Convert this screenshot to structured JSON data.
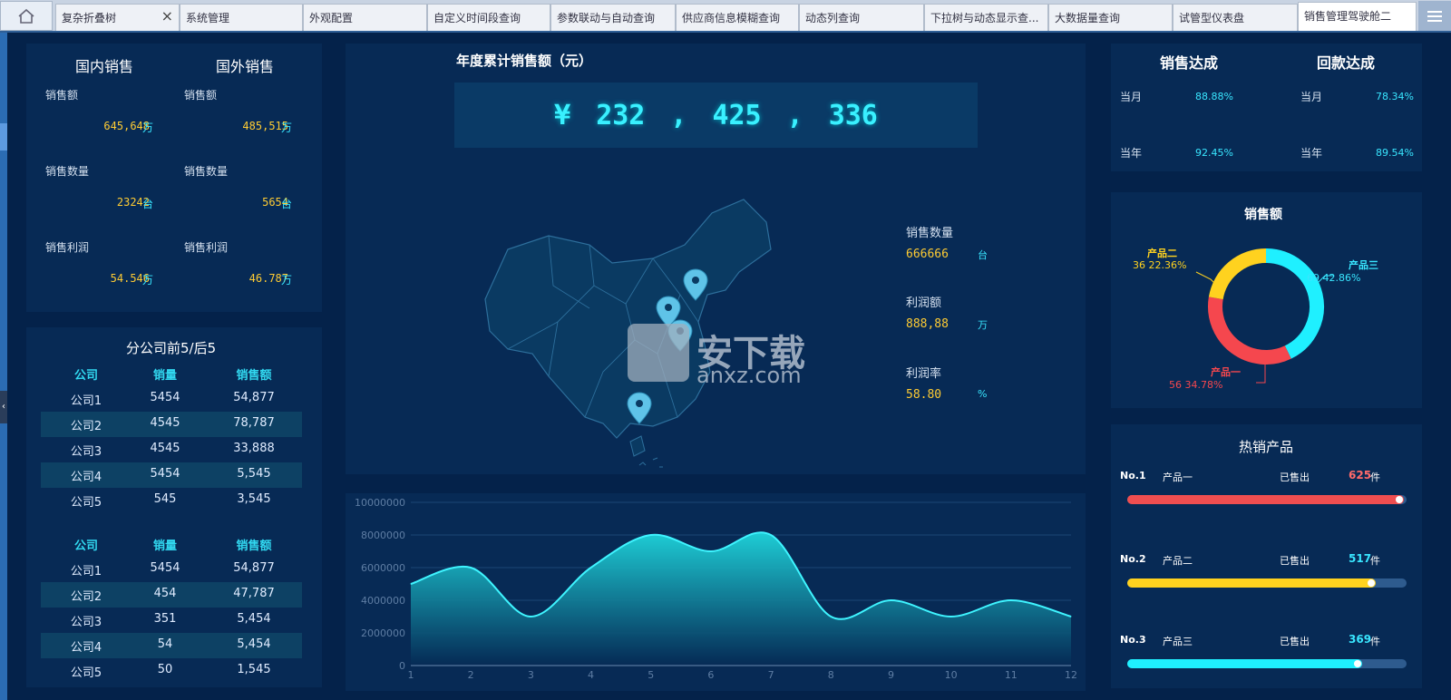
{
  "tabs": [
    {
      "label": "复杂折叠树",
      "closable": true
    },
    {
      "label": "系统管理"
    },
    {
      "label": "外观配置"
    },
    {
      "label": "自定义时间段查询"
    },
    {
      "label": "参数联动与自动查询"
    },
    {
      "label": "供应商信息模糊查询"
    },
    {
      "label": "动态列查询"
    },
    {
      "label": "下拉树与动态显示查..."
    },
    {
      "label": "大数据量查询"
    },
    {
      "label": "试管型仪表盘"
    },
    {
      "label": "销售管理驾驶舱二",
      "active": true
    }
  ],
  "sales_summary": {
    "domestic_title": "国内销售",
    "foreign_title": "国外销售",
    "domestic": [
      {
        "label": "销售额",
        "value": "645,648",
        "unit": "万"
      },
      {
        "label": "销售数量",
        "value": "23242",
        "unit": "台"
      },
      {
        "label": "销售利润",
        "value": "54.546",
        "unit": "万"
      }
    ],
    "foreign": [
      {
        "label": "销售额",
        "value": "485,515",
        "unit": "万"
      },
      {
        "label": "销售数量",
        "value": "5654",
        "unit": "台"
      },
      {
        "label": "销售利润",
        "value": "46.787",
        "unit": "万"
      }
    ]
  },
  "branches": {
    "title": "分公司前5/后5",
    "headers": [
      "公司",
      "销量",
      "销售额"
    ],
    "top5": [
      [
        "公司1",
        "5454",
        "54,877"
      ],
      [
        "公司2",
        "4545",
        "78,787"
      ],
      [
        "公司3",
        "4545",
        "33,888"
      ],
      [
        "公司4",
        "5454",
        "5,545"
      ],
      [
        "公司5",
        "545",
        "3,545"
      ]
    ],
    "bottom5": [
      [
        "公司1",
        "5454",
        "54,877"
      ],
      [
        "公司2",
        "454",
        "47,787"
      ],
      [
        "公司3",
        "351",
        "5,454"
      ],
      [
        "公司4",
        "54",
        "5,454"
      ],
      [
        "公司5",
        "50",
        "1,545"
      ]
    ]
  },
  "annual": {
    "title": "年度累计销售额（元）",
    "currency": "¥",
    "groups": [
      "232",
      ",",
      "425",
      ",",
      "336"
    ]
  },
  "map_stats": [
    {
      "label": "销售数量",
      "value": "666666",
      "unit": "台"
    },
    {
      "label": "利润额",
      "value": "888,88",
      "unit": "万"
    },
    {
      "label": "利润率",
      "value": "58.80",
      "unit": "%"
    }
  ],
  "watermark": {
    "cn": "安下载",
    "en": "anxz.com"
  },
  "achievement": {
    "sales_title": "销售达成",
    "payment_title": "回款达成",
    "month_label": "当月",
    "year_label": "当年",
    "sales_month": "88.88%",
    "sales_year": "92.45%",
    "payment_month": "78.34%",
    "payment_year": "89.54%"
  },
  "donut": {
    "title": "销售额",
    "labels": [
      {
        "name": "产品二",
        "text": "36  22.36%"
      },
      {
        "name": "产品三",
        "text": "69  42.86%"
      },
      {
        "name": "产品一",
        "text": "56  34.78%"
      }
    ]
  },
  "hot_products": {
    "title": "热销产品",
    "sold_label": "已售出",
    "unit": "件",
    "items": [
      {
        "rank": "No.1",
        "name": "产品一",
        "count": "625",
        "fraction": 0.99,
        "color": "#ef4e50"
      },
      {
        "rank": "No.2",
        "name": "产品二",
        "count": "517",
        "fraction": 0.89,
        "color": "#ffd21f"
      },
      {
        "rank": "No.3",
        "name": "产品三",
        "count": "369",
        "fraction": 0.84,
        "color": "#1ff0ff"
      }
    ]
  },
  "colors": {
    "bg": "#04224a",
    "panel": "#072a55",
    "accent": "#39e6ff",
    "yellow": "#ffcc33",
    "red": "#ef4e50"
  },
  "chart_data": [
    {
      "type": "pie",
      "title": "销售额",
      "labels": [
        "产品一",
        "产品二",
        "产品三"
      ],
      "values": [
        56,
        36,
        69
      ],
      "percent": [
        34.78,
        22.36,
        42.86
      ],
      "colors": [
        "#f5474e",
        "#ffd21f",
        "#1ff0ff"
      ]
    },
    {
      "type": "area",
      "x": [
        1,
        2,
        3,
        4,
        5,
        6,
        7,
        8,
        9,
        10,
        11,
        12
      ],
      "values": [
        5000000,
        6000000,
        3000000,
        6000000,
        8000000,
        7000000,
        8000000,
        3000000,
        4000000,
        3000000,
        4000000,
        3000000
      ],
      "yticks": [
        "0",
        "2000000",
        "4000000",
        "6000000",
        "8000000",
        "10000000"
      ],
      "ylim": [
        0,
        10000000
      ],
      "grid": true
    }
  ]
}
